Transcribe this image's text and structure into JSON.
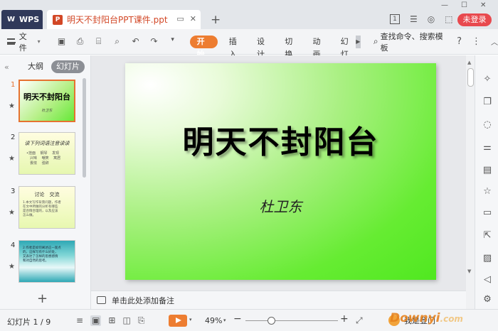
{
  "titlebar": {
    "app_tab": "WPS",
    "doc_tab_title": "明天不封阳台PPT课件.ppt",
    "badge": "1",
    "login": "未登录"
  },
  "ribbon": {
    "file_menu": "文件",
    "tabs": [
      "开始",
      "插入",
      "设计",
      "切换",
      "动画",
      "幻灯"
    ],
    "search": "查找命令、搜索模板",
    "help": "?"
  },
  "left_panel": {
    "tabs": [
      "大纲",
      "幻灯片"
    ],
    "thumbs": [
      {
        "num": "1",
        "title": "明天不封阳台",
        "sub": "杜卫东"
      },
      {
        "num": "2",
        "title": "读下列词语注音读读",
        "lines": [
          "•挂面　 钢琴　 发现",
          "　兴味　 嘲笑　 寓居",
          "　畏怯　 强辞"
        ]
      },
      {
        "num": "3",
        "title": "讨论　交流",
        "lines": [
          "1.本文写作背景问题，作者",
          "在文中所做的分析有哪些",
          "是合情合理的，以及应该",
          "怎么做。"
        ]
      },
      {
        "num": "4",
        "lines": [
          "2.作者是如何阐述这一观点",
          "的，这样写有什么好处，",
          "又表达了怎样的思想感情",
          "和对自然的思考。"
        ]
      }
    ]
  },
  "slide": {
    "title": "明天不封阳台",
    "subtitle": "杜卫东"
  },
  "notes": {
    "placeholder": "单击此处添加备注"
  },
  "status": {
    "slide_count": "幻灯片 1 / 9",
    "zoom": "49%",
    "zoom_level": 0.28,
    "login_hint": "我是登门"
  },
  "watermark": {
    "brand": "Downyi",
    "suffix": ".com"
  },
  "colors": {
    "accent": "#ed7d31",
    "login": "#e8494e",
    "title_tab": "#d24726"
  }
}
